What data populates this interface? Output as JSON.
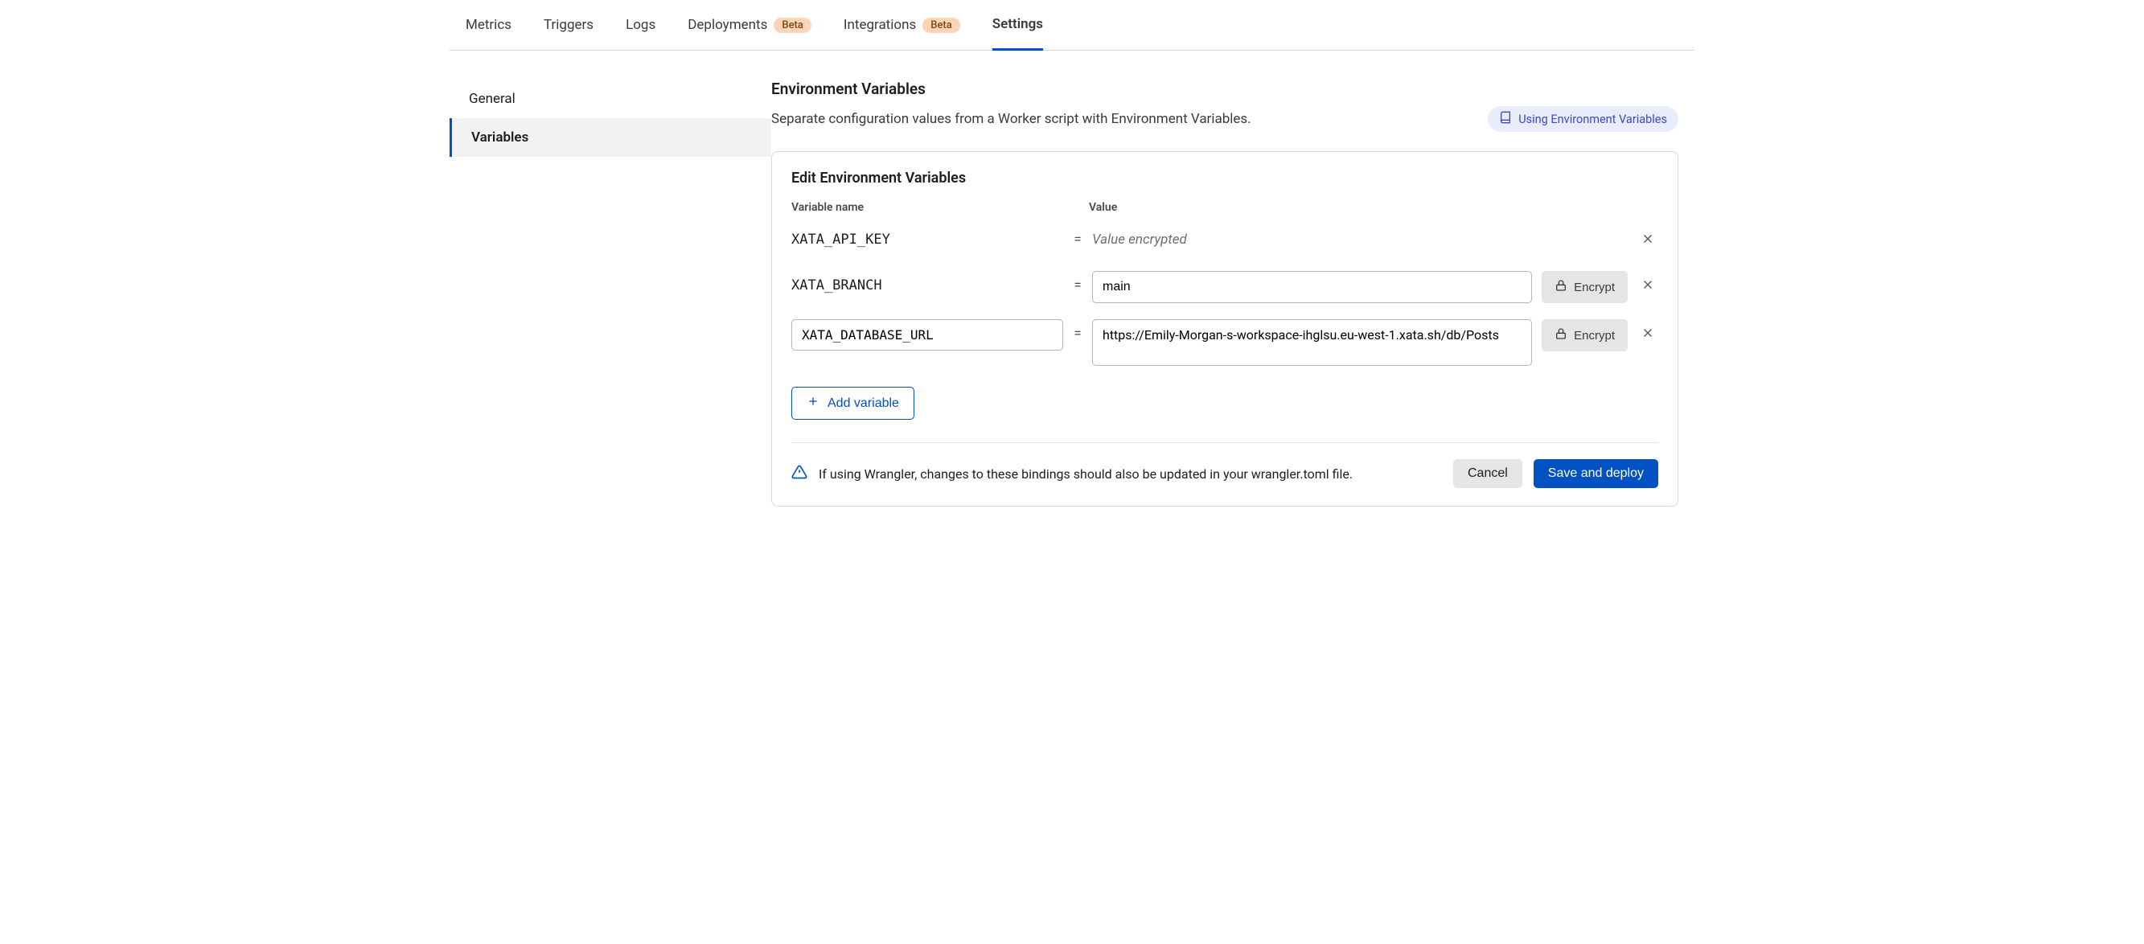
{
  "tabs": [
    {
      "label": "Metrics",
      "badge": null
    },
    {
      "label": "Triggers",
      "badge": null
    },
    {
      "label": "Logs",
      "badge": null
    },
    {
      "label": "Deployments",
      "badge": "Beta"
    },
    {
      "label": "Integrations",
      "badge": "Beta"
    },
    {
      "label": "Settings",
      "badge": null
    }
  ],
  "active_tab": "Settings",
  "sidebar": {
    "items": [
      {
        "label": "General"
      },
      {
        "label": "Variables"
      }
    ],
    "active": "Variables"
  },
  "section": {
    "title": "Environment Variables",
    "description": "Separate configuration values from a Worker script with Environment Variables.",
    "doc_link_label": "Using Environment Variables"
  },
  "panel": {
    "title": "Edit Environment Variables",
    "header_name": "Variable name",
    "header_value": "Value",
    "encrypted_placeholder": "Value encrypted",
    "encrypt_label": "Encrypt",
    "rows": [
      {
        "name": "XATA_API_KEY",
        "value": "",
        "encrypted": true,
        "name_editable": false
      },
      {
        "name": "XATA_BRANCH",
        "value": "main",
        "encrypted": false,
        "name_editable": false
      },
      {
        "name": "XATA_DATABASE_URL",
        "value": "https://Emily-Morgan-s-workspace-ihglsu.eu-west-1.xata.sh/db/Posts",
        "encrypted": false,
        "name_editable": true
      }
    ],
    "add_label": "Add variable",
    "footer_warning": "If using Wrangler, changes to these bindings should also be updated in your wrangler.toml file.",
    "cancel_label": "Cancel",
    "save_label": "Save and deploy"
  }
}
